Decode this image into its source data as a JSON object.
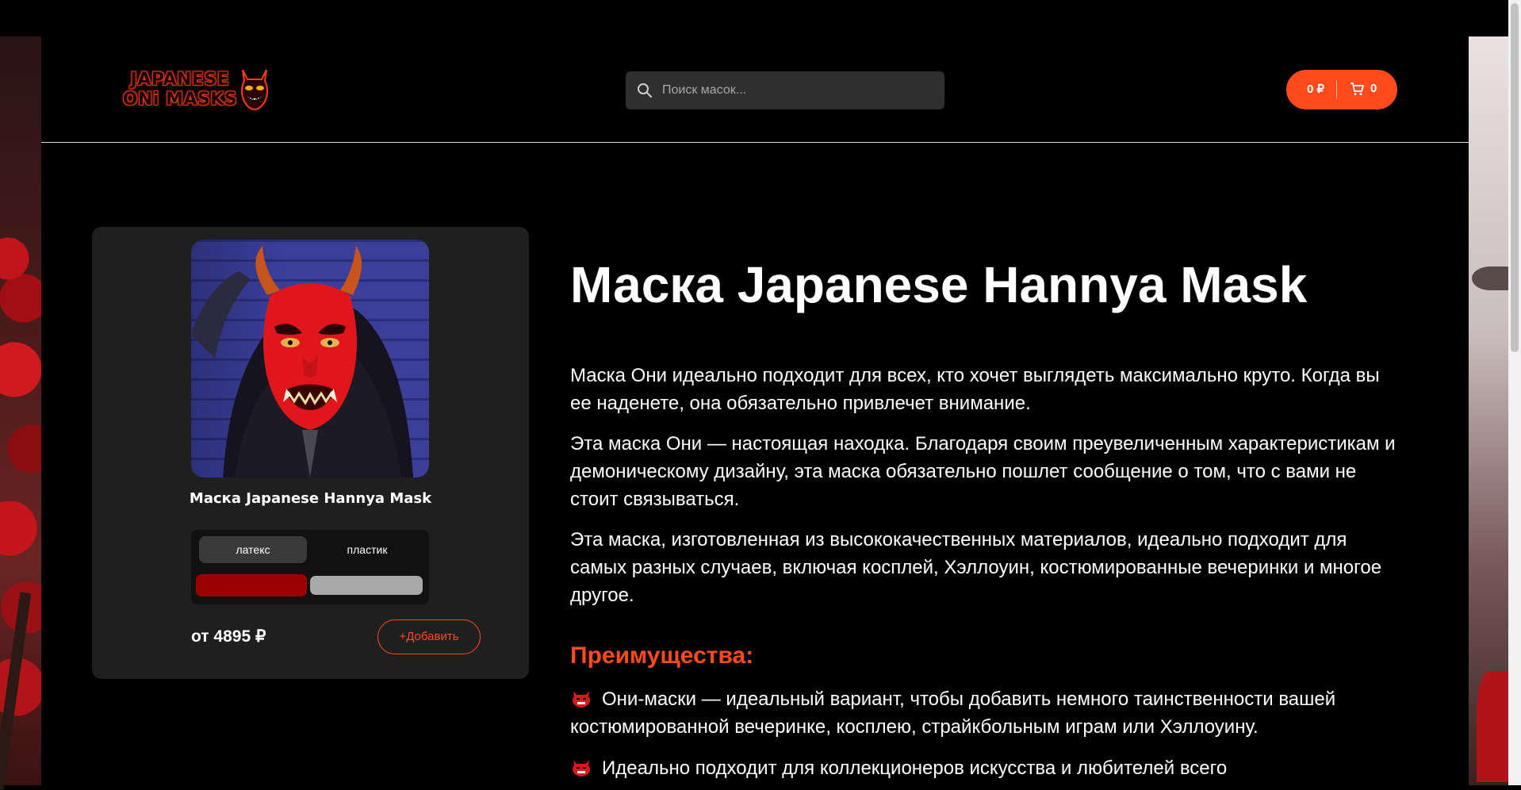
{
  "header": {
    "logo_text": "JAPANESE ONi MASKS",
    "search_placeholder": "Поиск масок...",
    "cart_sum": "0 ₽",
    "cart_count": "0"
  },
  "product_card": {
    "title": "Маска Japanese Hannya Mask",
    "variants": [
      "латекс",
      "пластик"
    ],
    "selected_variant": "латекс",
    "colors": [
      "#9a0000",
      "#a8a8a8"
    ],
    "price": "от 4895 ₽",
    "add_button": "+Добавить"
  },
  "description": {
    "title": "Маска Japanese Hannya Mask",
    "paragraphs": [
      "Маска Они идеально подходит для всех, кто хочет выглядеть максимально круто. Когда вы ее наденете, она обязательно привлечет внимание.",
      "Эта маска Они — настоящая находка. Благодаря своим преувеличенным характеристикам и демоническому дизайну, эта маска обязательно пошлет сообщение о том, что с вами не стоит связываться.",
      "Эта маска, изготовленная из высококачественных материалов, идеально подходит для самых разных случаев, включая косплей, Хэллоуин, костюмированные вечеринки и многое другое."
    ],
    "advantages_title": "Преимущества:",
    "advantages": [
      "Они-маски — идеальный вариант, чтобы добавить немного таинственности вашей костюмированной вечеринке, косплею, страйкбольным играм или Хэллоуину.",
      "Идеально подходит для коллекционеров искусства и любителей всего"
    ]
  },
  "colors": {
    "accent": "#ff4a1c",
    "background": "#000000",
    "card": "#1f1f1f"
  }
}
